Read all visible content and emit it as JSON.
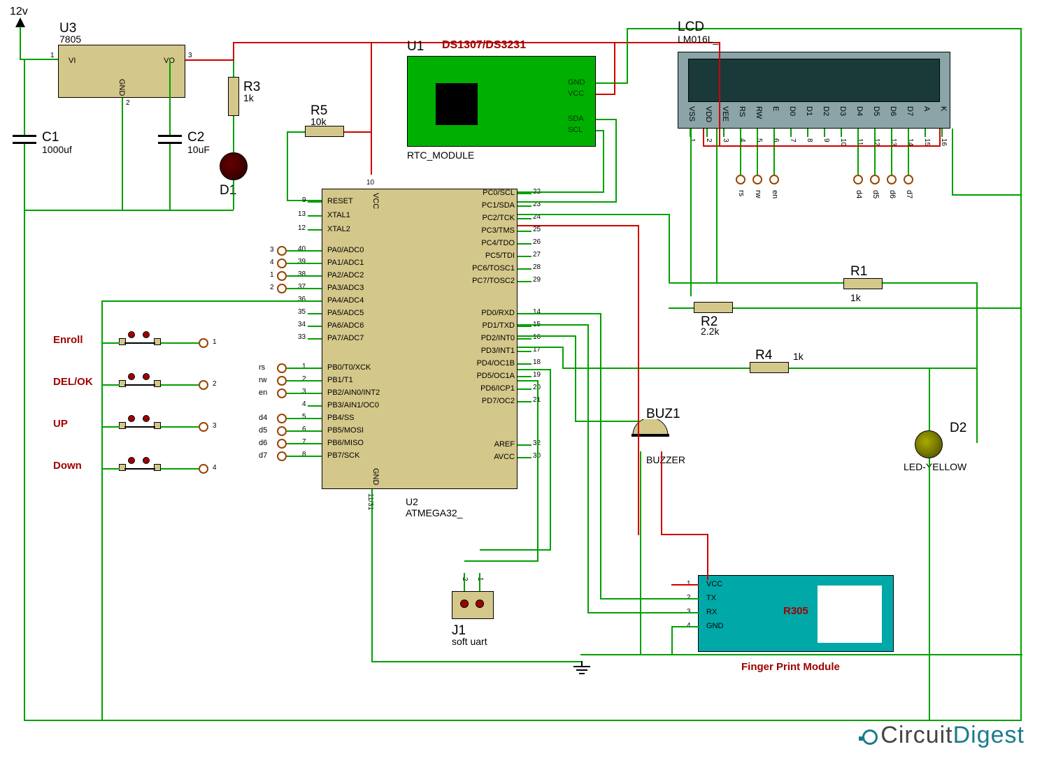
{
  "power": {
    "vin": "12v",
    "reg": {
      "ref": "U3",
      "type": "7805",
      "pins": {
        "vi": "VI",
        "vo": "VO",
        "gnd": "GND"
      },
      "pin_nums": [
        "1",
        "2",
        "3"
      ]
    }
  },
  "caps": {
    "c1": {
      "ref": "C1",
      "val": "1000uf"
    },
    "c2": {
      "ref": "C2",
      "val": "10uF"
    }
  },
  "leds": {
    "d1": {
      "ref": "D1"
    },
    "d2": {
      "ref": "D2",
      "type": "LED-YELLOW"
    }
  },
  "resistors": {
    "r1": {
      "ref": "R1",
      "val": "1k"
    },
    "r2": {
      "ref": "R2",
      "val": "2.2k"
    },
    "r3": {
      "ref": "R3",
      "val": "1k"
    },
    "r4": {
      "ref": "R4",
      "val": "1k"
    },
    "r5": {
      "ref": "R5",
      "val": "10k"
    }
  },
  "buttons": {
    "enroll": "Enroll",
    "del": "DEL/OK",
    "up": "UP",
    "down": "Down",
    "terms": [
      "1",
      "2",
      "3",
      "4"
    ]
  },
  "mcu": {
    "ref": "U2",
    "type": "ATMEGA32_",
    "left_top": [
      {
        "n": "9",
        "l": "RESET"
      },
      {
        "n": "13",
        "l": "XTAL1"
      },
      {
        "n": "12",
        "l": "XTAL2"
      }
    ],
    "pa": [
      {
        "n": "40",
        "l": "PA0/ADC0",
        "t": "3"
      },
      {
        "n": "39",
        "l": "PA1/ADC1",
        "t": "4"
      },
      {
        "n": "38",
        "l": "PA2/ADC2",
        "t": "1"
      },
      {
        "n": "37",
        "l": "PA3/ADC3",
        "t": "2"
      },
      {
        "n": "36",
        "l": "PA4/ADC4"
      },
      {
        "n": "35",
        "l": "PA5/ADC5"
      },
      {
        "n": "34",
        "l": "PA6/ADC6"
      },
      {
        "n": "33",
        "l": "PA7/ADC7"
      }
    ],
    "pb": [
      {
        "n": "1",
        "l": "PB0/T0/XCK",
        "net": "rs"
      },
      {
        "n": "2",
        "l": "PB1/T1",
        "net": "rw"
      },
      {
        "n": "3",
        "l": "PB2/AIN0/INT2",
        "net": "en"
      },
      {
        "n": "4",
        "l": "PB3/AIN1/OC0"
      },
      {
        "n": "5",
        "l": "PB4/SS",
        "net": "d4"
      },
      {
        "n": "6",
        "l": "PB5/MOSI",
        "net": "d5"
      },
      {
        "n": "7",
        "l": "PB6/MISO",
        "net": "d6"
      },
      {
        "n": "8",
        "l": "PB7/SCK",
        "net": "d7"
      }
    ],
    "pc": [
      {
        "n": "22",
        "l": "PC0/SCL"
      },
      {
        "n": "23",
        "l": "PC1/SDA"
      },
      {
        "n": "24",
        "l": "PC2/TCK"
      },
      {
        "n": "25",
        "l": "PC3/TMS"
      },
      {
        "n": "26",
        "l": "PC4/TDO"
      },
      {
        "n": "27",
        "l": "PC5/TDI"
      },
      {
        "n": "28",
        "l": "PC6/TOSC1"
      },
      {
        "n": "29",
        "l": "PC7/TOSC2"
      }
    ],
    "pd": [
      {
        "n": "14",
        "l": "PD0/RXD"
      },
      {
        "n": "15",
        "l": "PD1/TXD"
      },
      {
        "n": "16",
        "l": "PD2/INT0"
      },
      {
        "n": "17",
        "l": "PD3/INT1"
      },
      {
        "n": "18",
        "l": "PD4/OC1B"
      },
      {
        "n": "19",
        "l": "PD5/OC1A"
      },
      {
        "n": "20",
        "l": "PD6/ICP1"
      },
      {
        "n": "21",
        "l": "PD7/OC2"
      }
    ],
    "misc": [
      {
        "n": "32",
        "l": "AREF"
      },
      {
        "n": "30",
        "l": "AVCC"
      }
    ],
    "vcc": "VCC",
    "vcc_n": "10",
    "gnd": "GND",
    "gnd_n": "11/31"
  },
  "rtc": {
    "ref": "U1",
    "chip": "DS1307/DS3231",
    "type": "RTC_MODULE",
    "pins": [
      "GND",
      "VCC",
      "SDA",
      "SCL"
    ]
  },
  "lcd": {
    "ref": "LCD",
    "type": "LM016L_",
    "pins": [
      "VSS",
      "VDD",
      "VEE",
      "RS",
      "RW",
      "E",
      "D0",
      "D1",
      "D2",
      "D3",
      "D4",
      "D5",
      "D6",
      "D7",
      "A",
      "K"
    ],
    "nums": [
      "1",
      "2",
      "3",
      "4",
      "5",
      "6",
      "7",
      "8",
      "9",
      "10",
      "11",
      "12",
      "13",
      "14",
      "15",
      "16"
    ],
    "nets": [
      "rs",
      "rw",
      "en",
      "d4",
      "d5",
      "d6",
      "d7"
    ]
  },
  "buzzer": {
    "ref": "BUZ1",
    "type": "BUZZER"
  },
  "conn": {
    "ref": "J1",
    "type": "soft uart",
    "pins": [
      "1",
      "2"
    ]
  },
  "fp": {
    "chip": "R305",
    "label": "Finger Print Module",
    "pins": [
      {
        "n": "1",
        "l": "VCC"
      },
      {
        "n": "2",
        "l": "TX"
      },
      {
        "n": "3",
        "l": "RX"
      },
      {
        "n": "4",
        "l": "GND"
      }
    ]
  },
  "logo": {
    "c": "C",
    "ircuit": "ircuit",
    "d": "D",
    "igest": "igest"
  }
}
